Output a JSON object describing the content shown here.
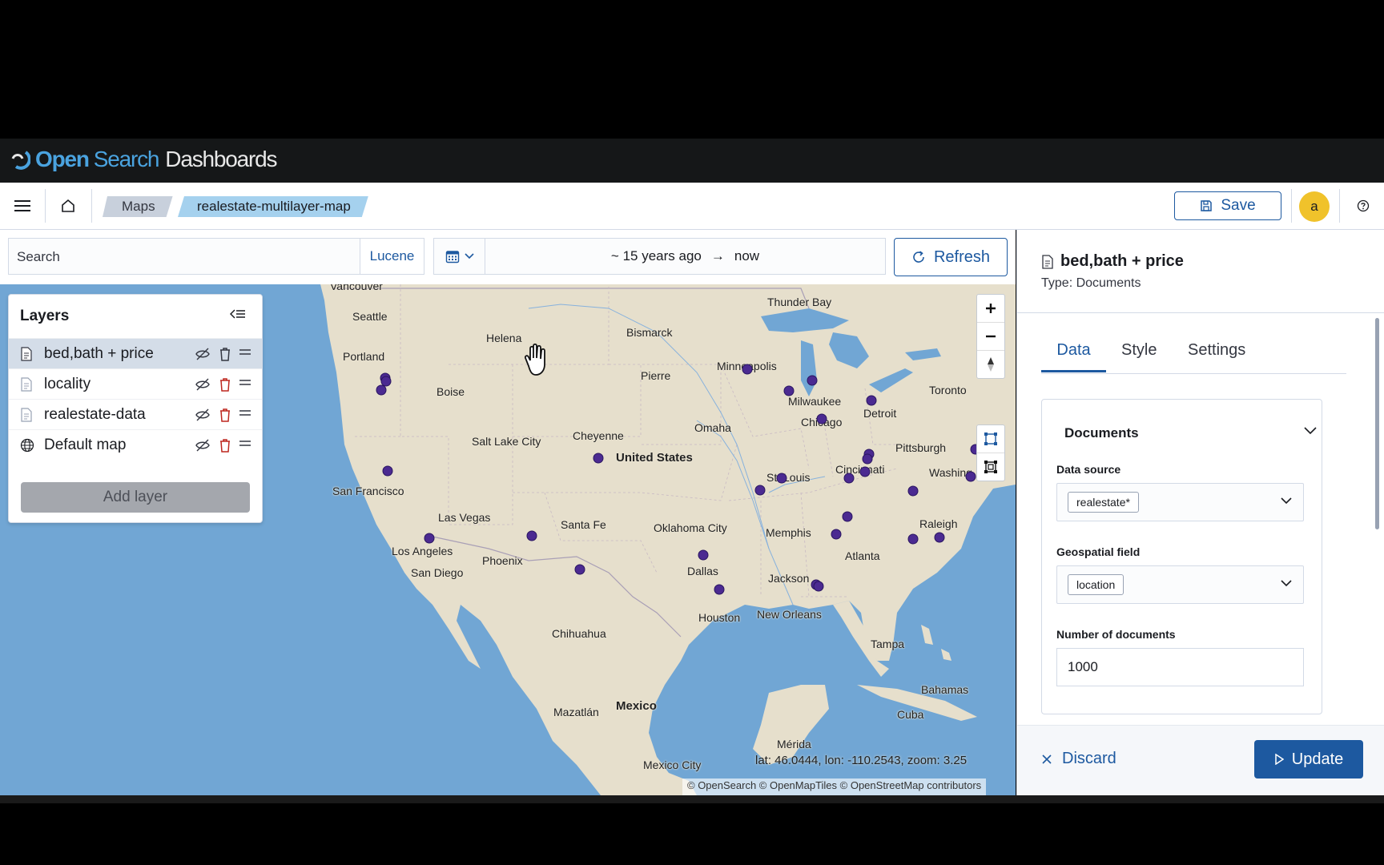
{
  "brand": {
    "open": "Open",
    "search": "Search",
    "dashboards": "Dashboards"
  },
  "breadcrumbs": [
    {
      "label": "Maps"
    },
    {
      "label": "realestate-multilayer-map"
    }
  ],
  "header": {
    "save_label": "Save",
    "avatar_initial": "a"
  },
  "query": {
    "search_placeholder": "Search",
    "language": "Lucene",
    "date_start": "~ 15 years ago",
    "date_arrow": "→",
    "date_end": "now",
    "refresh_label": "Refresh"
  },
  "layers": {
    "title": "Layers",
    "items": [
      {
        "name": "bed,bath + price",
        "icon": "document-icon"
      },
      {
        "name": "locality",
        "icon": "document-icon"
      },
      {
        "name": "realestate-data",
        "icon": "document-icon"
      },
      {
        "name": "Default map",
        "icon": "globe-icon"
      }
    ],
    "add_label": "Add layer"
  },
  "map": {
    "labels": {
      "vancouver": "Vancouver",
      "seattle": "Seattle",
      "portland": "Portland",
      "helena": "Helena",
      "boise": "Boise",
      "bismarck": "Bismarck",
      "pierre": "Pierre",
      "thunder_bay": "Thunder Bay",
      "minneapolis": "Minneapolis",
      "milwaukee": "Milwaukee",
      "chicago": "Chicago",
      "detroit": "Detroit",
      "toronto": "Toronto",
      "salt_lake": "Salt Lake City",
      "cheyenne": "Cheyenne",
      "omaha": "Omaha",
      "united_states": "United States",
      "san_francisco": "San Francisco",
      "las_vegas": "Las Vegas",
      "st_louis": "St. Louis",
      "cincinnati": "Cincinnati",
      "pittsburgh": "Pittsburgh",
      "washington": "Washing",
      "santa_fe": "Santa Fe",
      "oklahoma_city": "Oklahoma City",
      "memphis": "Memphis",
      "raleigh": "Raleigh",
      "los_angeles": "Los Angeles",
      "san_diego": "San Diego",
      "phoenix": "Phoenix",
      "atlanta": "Atlanta",
      "dallas": "Dallas",
      "jackson": "Jackson",
      "houston": "Houston",
      "new_orleans": "New Orleans",
      "tampa": "Tampa",
      "chihuahua": "Chihuahua",
      "bahamas": "Bahamas",
      "mexico": "Mexico",
      "mazatlan": "Mazatlán",
      "cuba": "Cuba",
      "merida": "Mérida",
      "mexico_city": "Mexico City"
    },
    "coords": "lat: 46.0444, lon: -110.2543, zoom: 3.25",
    "attribution": "© OpenSearch © OpenMapTiles © OpenStreetMap contributors",
    "point_color": "#4b2a91"
  },
  "panel": {
    "title": "bed,bath + price",
    "type": "Type: Documents",
    "tabs": [
      "Data",
      "Style",
      "Settings"
    ],
    "documents_title": "Documents",
    "data_source_label": "Data source",
    "data_source_value": "realestate*",
    "geo_field_label": "Geospatial field",
    "geo_field_value": "location",
    "num_docs_label": "Number of documents",
    "num_docs_value": "1000",
    "discard_label": "Discard",
    "update_label": "Update"
  },
  "colors": {
    "primary": "#1d59a0",
    "topbar": "#151718",
    "brand": "#4aa3df",
    "water": "#71a6d4",
    "land": "#e6dfcc"
  }
}
